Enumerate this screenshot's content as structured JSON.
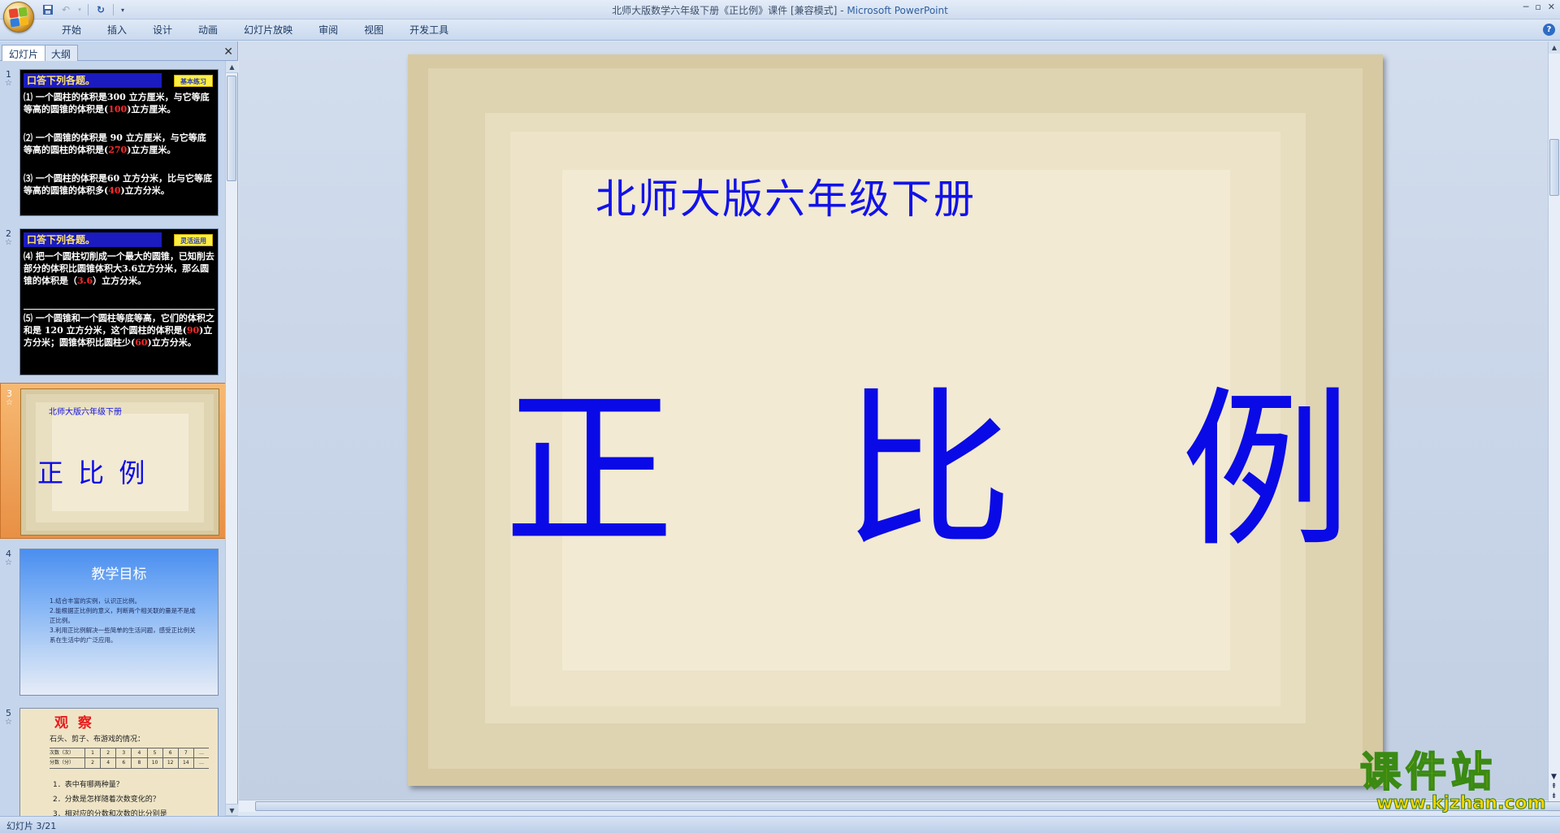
{
  "window": {
    "title_prefix": "北师大版数学六年级下册《正比例》课件 [兼容模式] - ",
    "app_name": "Microsoft PowerPoint"
  },
  "quick_access": [
    "save-icon",
    "undo-icon",
    "redo-icon",
    "customize-icon"
  ],
  "ribbon": {
    "tabs": [
      "开始",
      "插入",
      "设计",
      "动画",
      "幻灯片放映",
      "审阅",
      "视图",
      "开发工具"
    ]
  },
  "panel": {
    "tab_slides": "幻灯片",
    "tab_outline": "大纲",
    "close": "✕"
  },
  "thumbnails": {
    "t1": {
      "num": "1",
      "header": "口答下列各题。",
      "badge": "基本练习",
      "items": [
        {
          "a": "⑴ 一个圆柱的体积是300 立方厘米，与它等底等高的圆锥的体积是(",
          "ans": "100",
          "b": ")立方厘米。"
        },
        {
          "a": "⑵ 一个圆锥的体积是 90 立方厘米，与它等底等高的圆柱的体积是(",
          "ans": "270",
          "b": ")立方厘米。"
        },
        {
          "a": "⑶ 一个圆柱的体积是60 立方分米，比与它等底等高的圆锥的体积多(",
          "ans": "40",
          "b": ")立方分米。"
        }
      ]
    },
    "t2": {
      "num": "2",
      "header": "口答下列各题。",
      "badge": "灵活运用",
      "items": [
        {
          "a": "⑷ 把一个圆柱切削成一个最大的圆锥，已知削去部分的体积比圆锥体积大3.6立方分米，那么圆锥的体积是（",
          "ans": "3.6",
          "b": "）立方分米。"
        },
        {
          "a": "⑸ 一个圆锥和一个圆柱等底等高，它们的体积之和是 120 立方分米，这个圆柱的体积是(",
          "ans": "90",
          "b": ")立方分米；圆锥体积比圆柱少(",
          "ans2": "60",
          "c": ")立方分米。"
        }
      ]
    },
    "t3": {
      "num": "3",
      "subtitle": "北师大版六年级下册",
      "title": "正 比 例"
    },
    "t4": {
      "num": "4",
      "title": "教学目标",
      "lines": [
        "1.结合丰富的实例，认识正比例。",
        "2.能根据正比例的意义，判断两个相关联的量是不是成正比例。",
        "3.利用正比例解决一些简单的生活问题，感受正比例关系在生活中的广泛应用。"
      ]
    },
    "t5": {
      "num": "5",
      "title": "观  察",
      "intro": "石头、剪子、布游戏的情况：",
      "row1_label": "次数（次）",
      "row1": [
        "1",
        "2",
        "3",
        "4",
        "5",
        "6",
        "7",
        "…"
      ],
      "row2_label": "分数（分）",
      "row2": [
        "2",
        "4",
        "6",
        "8",
        "10",
        "12",
        "14",
        "…"
      ],
      "q1": "1．表中有哪两种量？",
      "q2": "2．分数是怎样随着次数变化的？",
      "q3": "3．相对应的分数和次数的比分别是"
    }
  },
  "slide": {
    "subtitle": "北师大版六年级下册",
    "title": "正 比 例"
  },
  "status": {
    "text": "幻灯片 3/21"
  },
  "watermark": {
    "title": "课件站",
    "url": "www.kjzhan.com"
  },
  "colors": {
    "slide_title": "#0a0ae6",
    "frame": "#d7c9a1",
    "cream": "#f2ead2",
    "selected_thumb": "#f0a85a"
  }
}
